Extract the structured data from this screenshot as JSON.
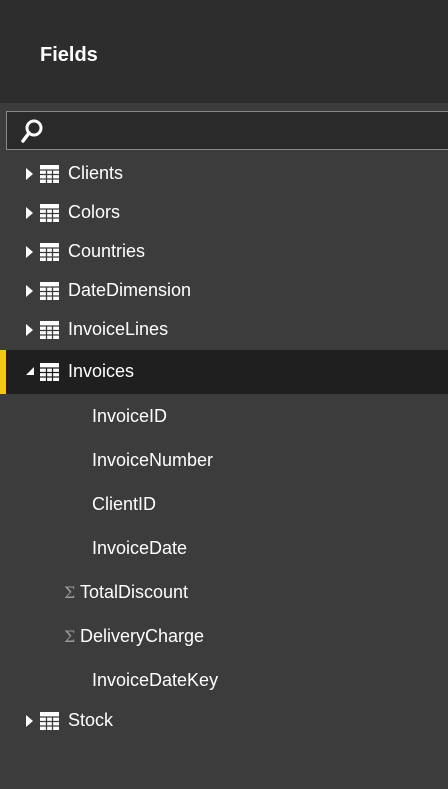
{
  "panel": {
    "title": "Fields"
  },
  "search": {
    "value": "",
    "placeholder": ""
  },
  "tables": [
    {
      "label": "Clients",
      "expanded": false
    },
    {
      "label": "Colors",
      "expanded": false
    },
    {
      "label": "Countries",
      "expanded": false
    },
    {
      "label": "DateDimension",
      "expanded": false
    },
    {
      "label": "InvoiceLines",
      "expanded": false
    },
    {
      "label": "Invoices",
      "expanded": true
    },
    {
      "label": "Stock",
      "expanded": false
    }
  ],
  "invoices_fields": [
    {
      "label": "InvoiceID",
      "type": "text"
    },
    {
      "label": "InvoiceNumber",
      "type": "text"
    },
    {
      "label": "ClientID",
      "type": "text"
    },
    {
      "label": "InvoiceDate",
      "type": "text"
    },
    {
      "label": "TotalDiscount",
      "type": "measure",
      "icon": "sigma-icon"
    },
    {
      "label": "DeliveryCharge",
      "type": "measure",
      "icon": "sigma-icon"
    },
    {
      "label": "InvoiceDateKey",
      "type": "text"
    }
  ],
  "colors": {
    "header_bg": "#2d2d2d",
    "panel_bg": "#3c3c3c",
    "selected_bg": "#1f1f1f",
    "accent": "#f2c811",
    "text": "#ffffff"
  }
}
